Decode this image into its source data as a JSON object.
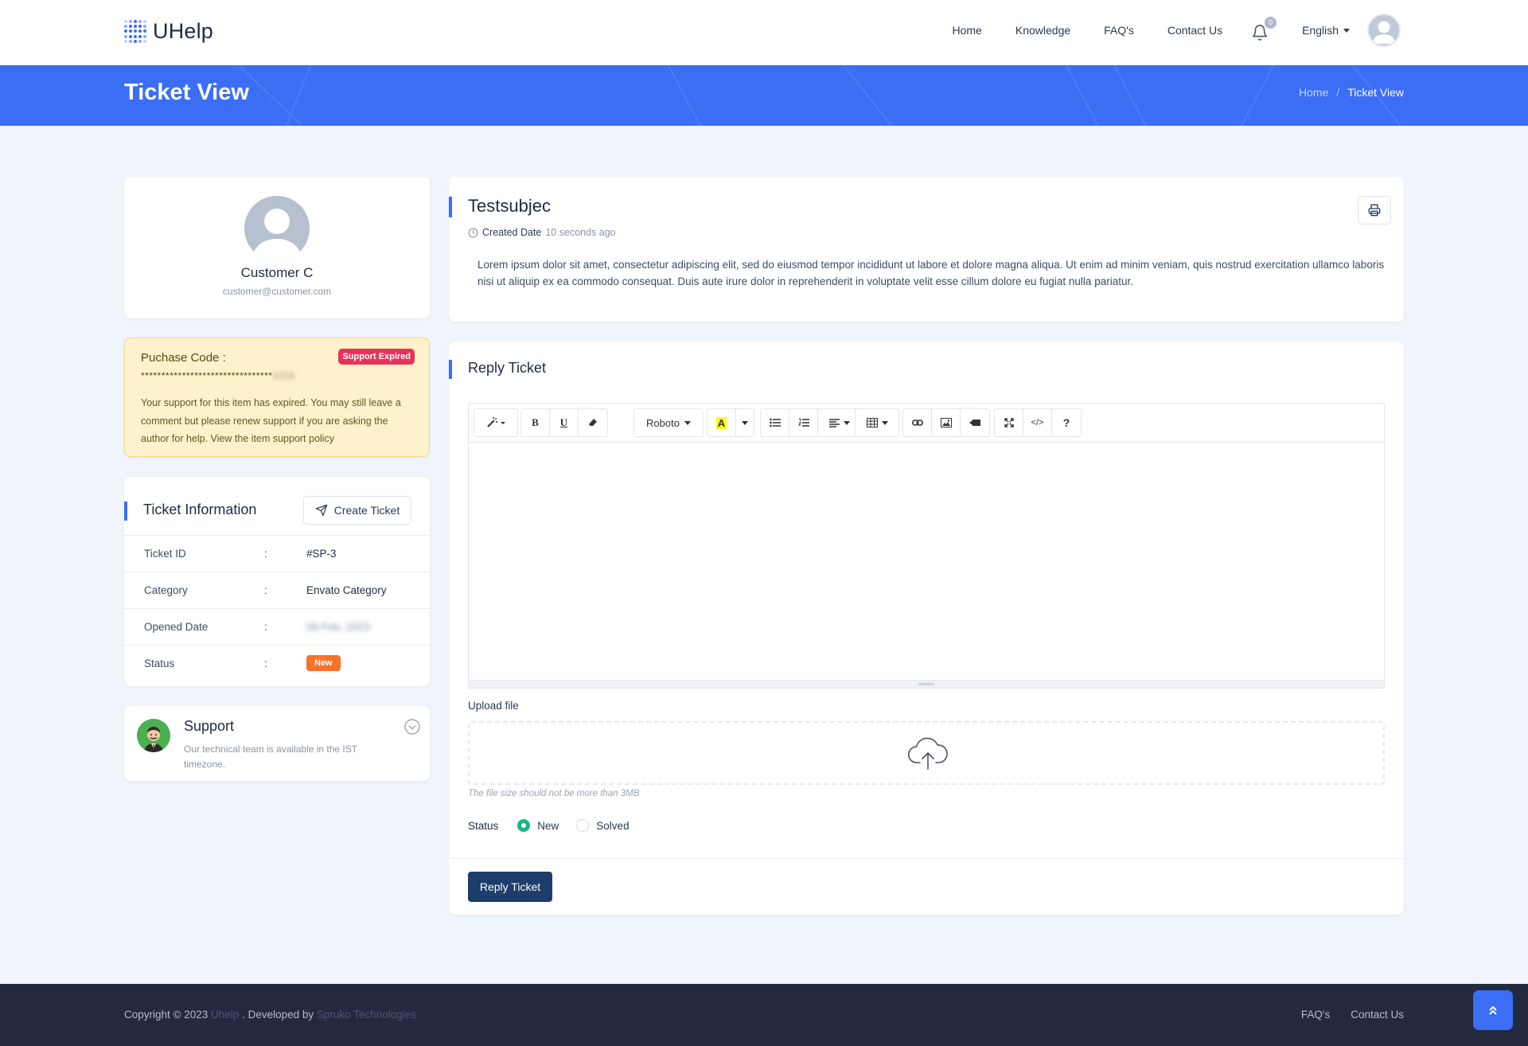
{
  "header": {
    "logo_text": "UHelp",
    "nav": [
      "Home",
      "Knowledge",
      "FAQ's",
      "Contact Us"
    ],
    "notification_count": "0",
    "language": "English"
  },
  "banner": {
    "title": "Ticket View",
    "breadcrumb": [
      "Home",
      "/",
      "Ticket View"
    ]
  },
  "profile": {
    "name": "Customer C",
    "email": "customer@customer.com"
  },
  "purchase": {
    "title": "Puchase Code :",
    "badge": "Support Expired",
    "code_masked": "********************************",
    "code_tail": "3256",
    "message": "Your support for this item has expired. You may still leave a comment but please renew support if you are asking the author for help. View the item support policy"
  },
  "ticket_info": {
    "title": "Ticket Information",
    "create_button": "Create Ticket",
    "rows": [
      {
        "key": "Ticket ID",
        "sep": ":",
        "value": "#SP-3"
      },
      {
        "key": "Category",
        "sep": ":",
        "value": "Envato Category"
      },
      {
        "key": "Opened Date",
        "sep": ":",
        "value": "08 Feb, 2023"
      },
      {
        "key": "Status",
        "sep": ":",
        "value": "New"
      }
    ]
  },
  "support": {
    "title": "Support",
    "text": "Our technical team is available in the IST timezone."
  },
  "ticket": {
    "subject": "Testsubjec",
    "created_label": "Created Date",
    "created_value": "10 seconds ago",
    "body": "Lorem ipsum dolor sit amet, consectetur adipiscing elit, sed do eiusmod tempor incididunt ut labore et dolore magna aliqua. Ut enim ad minim veniam, quis nostrud exercitation ullamco laboris nisi ut aliquip ex ea commodo consequat. Duis aute irure dolor in reprehenderit in voluptate velit esse cillum dolore eu fugiat nulla pariatur."
  },
  "reply": {
    "title": "Reply Ticket",
    "font_name": "Roboto",
    "toolbar_bold": "B",
    "toolbar_underline": "U",
    "toolbar_color_letter": "A",
    "toolbar_code": "</>",
    "toolbar_help": "?",
    "upload_label": "Upload file",
    "upload_hint": "The file size should not be more than 3MB",
    "status_label": "Status",
    "status_options": [
      "New",
      "Solved"
    ],
    "selected_status": "New",
    "submit": "Reply Ticket"
  },
  "footer": {
    "copyright_prefix": "Copyright © 2023",
    "brand": "Uhelp",
    "developed_by": ". Developed by",
    "company": "Spruko Technologies",
    "links": [
      "FAQ's",
      "Contact Us"
    ]
  },
  "colors": {
    "primary": "#3b6ef5",
    "danger": "#e7335a",
    "warning_bg": "#fdf2cc",
    "status_new": "#f5732a",
    "radio_on": "#16b58a",
    "button_dark": "#1d3d6b",
    "footer_bg": "#232a3e"
  },
  "icons": [
    "logo-dots-icon",
    "bell-icon",
    "chevron-down-icon",
    "user-avatar-icon",
    "send-icon",
    "clock-icon",
    "printer-icon",
    "magic-icon",
    "eraser-icon",
    "list-ul-icon",
    "list-ol-icon",
    "align-icon",
    "table-icon",
    "link-icon",
    "image-icon",
    "video-icon",
    "fullscreen-icon",
    "cloud-upload-icon",
    "angles-up-icon"
  ]
}
